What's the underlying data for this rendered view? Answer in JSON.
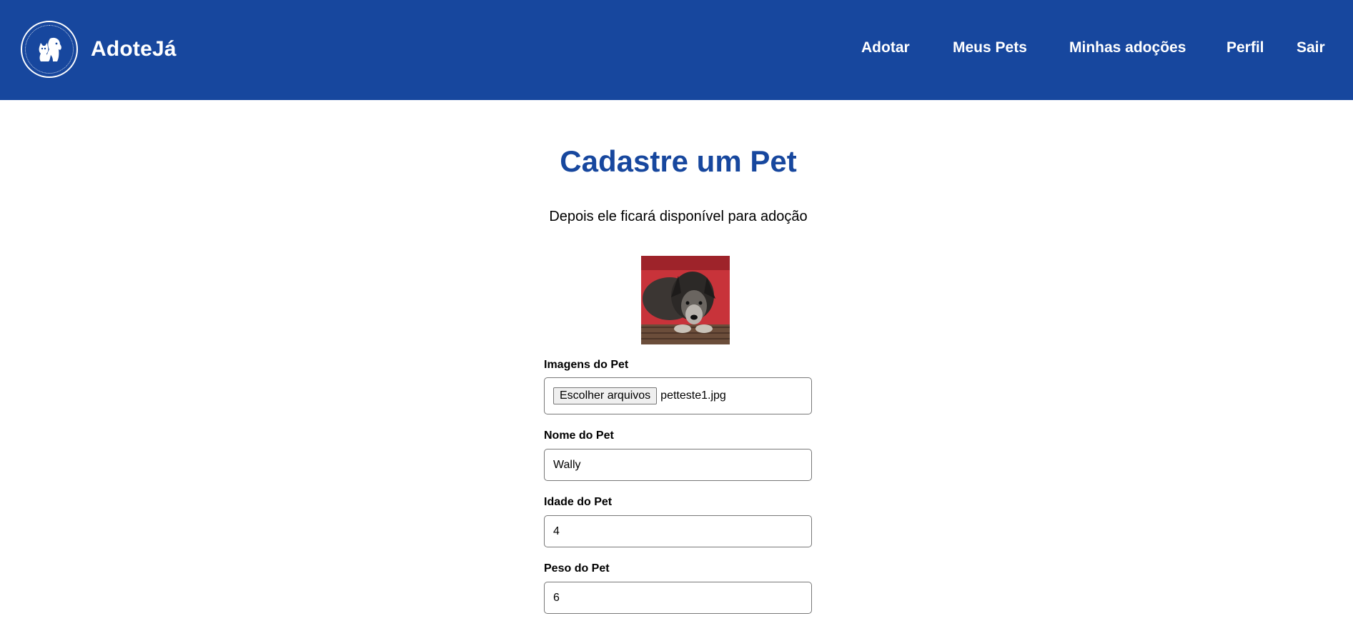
{
  "navbar": {
    "brand_name": "AdoteJá",
    "logo_icon": "dog-and-cat-logo-icon",
    "background_color": "#17479e",
    "links": [
      {
        "label": "Adotar"
      },
      {
        "label": "Meus Pets"
      },
      {
        "label": "Minhas adoções"
      },
      {
        "label": "Perfil"
      },
      {
        "label": "Sair"
      }
    ]
  },
  "main": {
    "title": "Cadastre um Pet",
    "subtitle": "Depois ele ficará disponível para adoção",
    "title_color": "#17479e"
  },
  "form": {
    "images": {
      "label": "Imagens do Pet",
      "button_label": "Escolher arquivos",
      "file_name": "petteste1.jpg"
    },
    "name": {
      "label": "Nome do Pet",
      "value": "Wally"
    },
    "age": {
      "label": "Idade do Pet",
      "value": "4"
    },
    "weight": {
      "label": "Peso do Pet",
      "value": "6"
    }
  }
}
